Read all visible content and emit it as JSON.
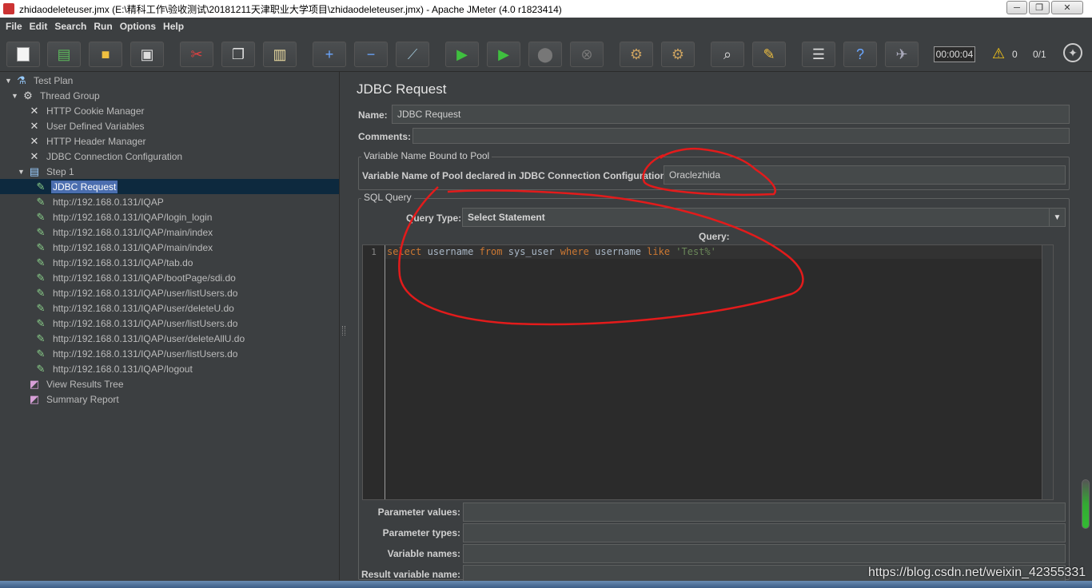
{
  "window": {
    "title": "zhidaodeleteuser.jmx (E:\\精科工作\\验收测试\\20181211天津职业大学项目\\zhidaodeleteuser.jmx) - Apache JMeter (4.0 r1823414)",
    "minimize": "─",
    "maximize": "❐",
    "close": "✕"
  },
  "menu": {
    "file": "File",
    "edit": "Edit",
    "search": "Search",
    "run": "Run",
    "options": "Options",
    "help": "Help"
  },
  "toolbar": {
    "timer": "00:00:04",
    "warning_count": "0",
    "threads": "0/1",
    "icons": [
      "new-icon",
      "templates-icon",
      "open-icon",
      "save-icon",
      "cut-icon",
      "copy-icon",
      "paste-icon",
      "expand-icon",
      "collapse-icon",
      "toggle-icon",
      "start-icon",
      "start-no-pause-icon",
      "stop-icon",
      "shutdown-icon",
      "clear-icon",
      "clear-all-icon",
      "search-icon",
      "reset-search-icon",
      "function-helper-icon",
      "help-icon",
      "log-viewer-icon"
    ]
  },
  "tree": {
    "test_plan": "Test Plan",
    "thread_group": "Thread Group",
    "cookie_manager": "HTTP Cookie Manager",
    "user_vars": "User Defined Variables",
    "header_manager": "HTTP Header Manager",
    "jdbc_config": "JDBC Connection Configuration",
    "step1": "Step 1",
    "samplers": [
      "JDBC Request",
      "http://192.168.0.131/IQAP",
      "http://192.168.0.131/IQAP/login_login",
      "http://192.168.0.131/IQAP/main/index",
      "http://192.168.0.131/IQAP/main/index",
      "http://192.168.0.131/IQAP/tab.do",
      "http://192.168.0.131/IQAP/bootPage/sdi.do",
      "http://192.168.0.131/IQAP/user/listUsers.do",
      "http://192.168.0.131/IQAP/user/deleteU.do",
      "http://192.168.0.131/IQAP/user/listUsers.do",
      "http://192.168.0.131/IQAP/user/deleteAllU.do",
      "http://192.168.0.131/IQAP/user/listUsers.do",
      "http://192.168.0.131/IQAP/logout"
    ],
    "view_results_tree": "View Results Tree",
    "summary_report": "Summary Report"
  },
  "panel": {
    "title": "JDBC Request",
    "name_label": "Name:",
    "name_value": "JDBC Request",
    "comments_label": "Comments:",
    "comments_value": "",
    "pool_group_title": "Variable Name Bound to Pool",
    "pool_label": "Variable Name of Pool declared in JDBC Connection Configuration:",
    "pool_value": "Oraclezhida",
    "sql_group_title": "SQL Query",
    "query_type_label": "Query Type:",
    "query_type_value": "Select Statement",
    "query_label": "Query:",
    "line_number": "1",
    "code": {
      "kw_select": "select",
      "id_username": " username ",
      "kw_from": "from",
      "id_table": " sys_user ",
      "kw_where": "where",
      "id_username2": " username ",
      "kw_like": "like",
      "str_value": " 'Test%'"
    },
    "param_values_label": "Parameter values:",
    "param_types_label": "Parameter types:",
    "variable_names_label": "Variable names:",
    "result_var_label": "Result variable name:"
  },
  "watermark": "https://blog.csdn.net/weixin_42355331",
  "colors": {
    "background": "#3c3f41",
    "selection": "#4b6eaf",
    "annotation": "#e31b1b"
  }
}
